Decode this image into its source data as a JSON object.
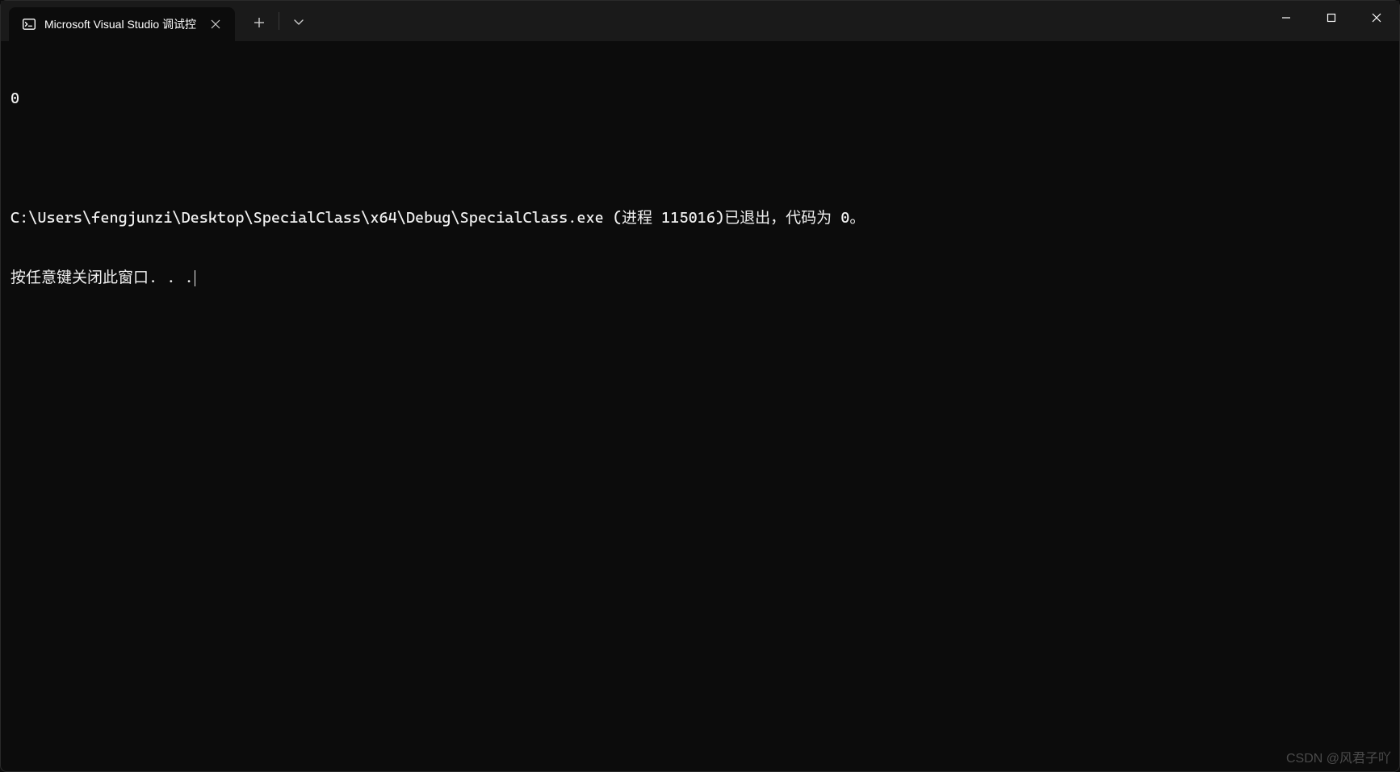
{
  "titlebar": {
    "tab": {
      "title": "Microsoft Visual Studio 调试控",
      "icon": "terminal-icon"
    },
    "newTab": "new-tab",
    "dropdown": "dropdown"
  },
  "windowControls": {
    "minimize": "minimize",
    "maximize": "maximize",
    "close": "close"
  },
  "terminal": {
    "lines": [
      "0",
      "",
      "C:\\Users\\fengjunzi\\Desktop\\SpecialClass\\x64\\Debug\\SpecialClass.exe (进程 115016)已退出，代码为 0。",
      "按任意键关闭此窗口. . ."
    ]
  },
  "watermark": "CSDN @风君子吖"
}
